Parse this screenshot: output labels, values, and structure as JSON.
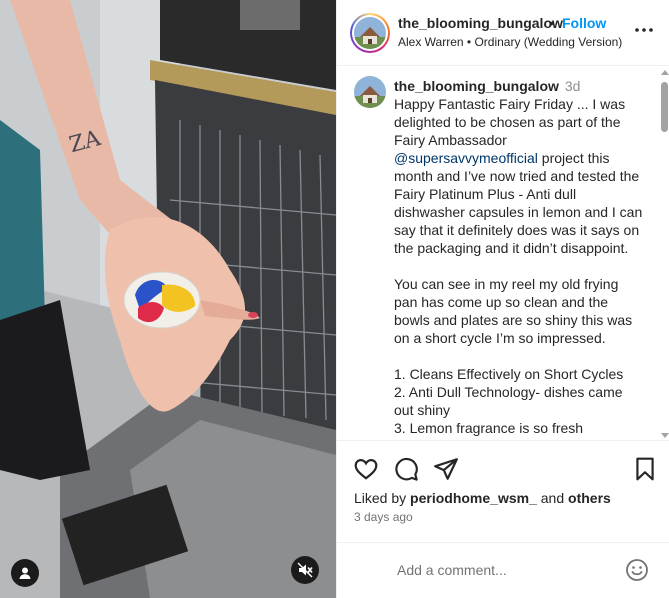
{
  "post": {
    "username": "the_blooming_bungalow",
    "separator": "•",
    "follow_label": "Follow",
    "audio_line": "Alex Warren • Ordinary (Wedding Version)"
  },
  "caption": {
    "username": "the_blooming_bungalow",
    "time": "3d",
    "text_before_mention": "Happy Fantastic Fairy Friday ... I was delighted to be chosen as part of the Fairy Ambassador ",
    "mention": "@supersavvymeofficial",
    "text_after_mention": " project this month and I’ve now tried and tested the Fairy Platinum Plus - Anti dull dishwasher capsules in lemon and I can say that it definitely does was it says on the packaging and it didn’t disappoint.\n\nYou can see in my reel my old frying pan has come up so clean and the bowls and plates are so shiny this was on a short cycle I’m so impressed.\n\n1. Cleans Effectively on Short Cycles\n2. Anti Dull Technology- dishes came out shiny\n3. Lemon fragrance is so fresh"
  },
  "engagement": {
    "liked_by_prefix": "Liked by ",
    "liked_by_user": "periodhome_wsm_",
    "liked_by_and": " and ",
    "liked_by_others": "others",
    "date": "3 days ago"
  },
  "comment": {
    "placeholder": "Add a comment..."
  },
  "icons": {
    "more": "more-horizontal-icon",
    "like": "heart-icon",
    "comment": "comment-bubble-icon",
    "share": "paper-plane-icon",
    "save": "bookmark-icon",
    "emoji": "smiley-icon",
    "user_tag": "user-tag-icon",
    "mute": "speaker-muted-icon"
  },
  "colors": {
    "follow_blue": "#0095f6",
    "mention_blue": "#00376b",
    "secondary_text": "#737373"
  }
}
